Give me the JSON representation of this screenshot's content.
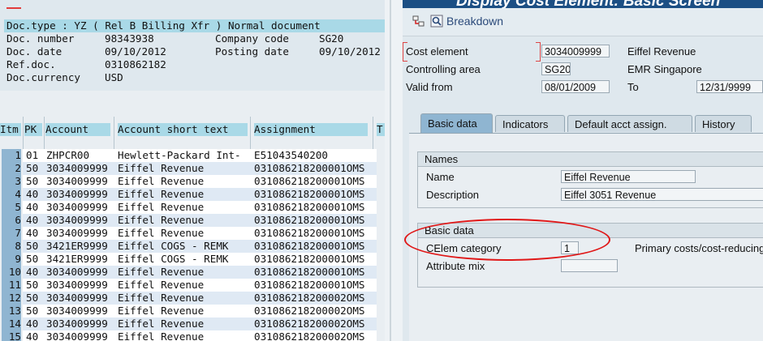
{
  "left": {
    "doc_type_line": "Doc.type : YZ ( Rel B Billing Xfr ) Normal document",
    "header_fields": [
      {
        "label": "Doc. number",
        "value": "98343938"
      },
      {
        "label": "Doc. date",
        "value": "09/10/2012"
      },
      {
        "label": "Ref.doc.",
        "value": "0310862182"
      },
      {
        "label": "Doc.currency",
        "value": "USD"
      }
    ],
    "company_code_label": "Company code",
    "company_code_value": "SG20",
    "posting_date_label": "Posting date",
    "posting_date_value": "09/10/2012",
    "columns": [
      "Itm",
      "PK",
      "Account",
      "Account short text",
      "Assignment",
      "T"
    ],
    "rows": [
      {
        "itm": "1",
        "pk": "01",
        "account": "ZHPCR00",
        "text": "Hewlett-Packard Int-",
        "assignment": "E51043540200"
      },
      {
        "itm": "2",
        "pk": "50",
        "account": "3034009999",
        "text": "Eiffel Revenue",
        "assignment": "031086218200001OMS"
      },
      {
        "itm": "3",
        "pk": "50",
        "account": "3034009999",
        "text": "Eiffel Revenue",
        "assignment": "031086218200001OMS"
      },
      {
        "itm": "4",
        "pk": "40",
        "account": "3034009999",
        "text": "Eiffel Revenue",
        "assignment": "031086218200001OMS"
      },
      {
        "itm": "5",
        "pk": "40",
        "account": "3034009999",
        "text": "Eiffel Revenue",
        "assignment": "031086218200001OMS"
      },
      {
        "itm": "6",
        "pk": "40",
        "account": "3034009999",
        "text": "Eiffel Revenue",
        "assignment": "031086218200001OMS"
      },
      {
        "itm": "7",
        "pk": "40",
        "account": "3034009999",
        "text": "Eiffel Revenue",
        "assignment": "031086218200001OMS"
      },
      {
        "itm": "8",
        "pk": "50",
        "account": "3421ER9999",
        "text": "Eiffel COGS - REMK",
        "assignment": "031086218200001OMS"
      },
      {
        "itm": "9",
        "pk": "50",
        "account": "3421ER9999",
        "text": "Eiffel COGS - REMK",
        "assignment": "031086218200001OMS"
      },
      {
        "itm": "10",
        "pk": "40",
        "account": "3034009999",
        "text": "Eiffel Revenue",
        "assignment": "031086218200001OMS"
      },
      {
        "itm": "11",
        "pk": "50",
        "account": "3034009999",
        "text": "Eiffel Revenue",
        "assignment": "031086218200001OMS"
      },
      {
        "itm": "12",
        "pk": "50",
        "account": "3034009999",
        "text": "Eiffel Revenue",
        "assignment": "031086218200002OMS"
      },
      {
        "itm": "13",
        "pk": "50",
        "account": "3034009999",
        "text": "Eiffel Revenue",
        "assignment": "031086218200002OMS"
      },
      {
        "itm": "14",
        "pk": "40",
        "account": "3034009999",
        "text": "Eiffel Revenue",
        "assignment": "031086218200002OMS"
      },
      {
        "itm": "15",
        "pk": "40",
        "account": "3034009999",
        "text": "Eiffel Revenue",
        "assignment": "031086218200002OMS"
      }
    ]
  },
  "right": {
    "title": "Display Cost Element: Basic Screen",
    "toolbar": {
      "breakdown_label": "Breakdown",
      "icons": [
        "hierarchy-icon",
        "breakdown-icon"
      ]
    },
    "cost_element_label": "Cost element",
    "cost_element_value": "3034009999",
    "cost_element_name": "Eiffel Revenue",
    "controlling_area_label": "Controlling area",
    "controlling_area_value": "SG20",
    "controlling_area_name": "EMR Singapore",
    "valid_from_label": "Valid from",
    "valid_from_value": "08/01/2009",
    "to_label": "To",
    "to_value": "12/31/9999",
    "tabs": [
      "Basic data",
      "Indicators",
      "Default acct assign.",
      "History"
    ],
    "names_group": {
      "title": "Names",
      "name_label": "Name",
      "name_value": "Eiffel Revenue",
      "description_label": "Description",
      "description_value": "Eiffel 3051 Revenue"
    },
    "basic_group": {
      "title": "Basic data",
      "celem_label": "CElem category",
      "celem_value": "1",
      "celem_desc": "Primary costs/cost-reducing revenues",
      "attribute_label": "Attribute mix",
      "attribute_value": ""
    }
  },
  "colors": {
    "accent": "#a9d9e7",
    "highlight": "#e01818",
    "title_bar": "#1c4f84"
  }
}
